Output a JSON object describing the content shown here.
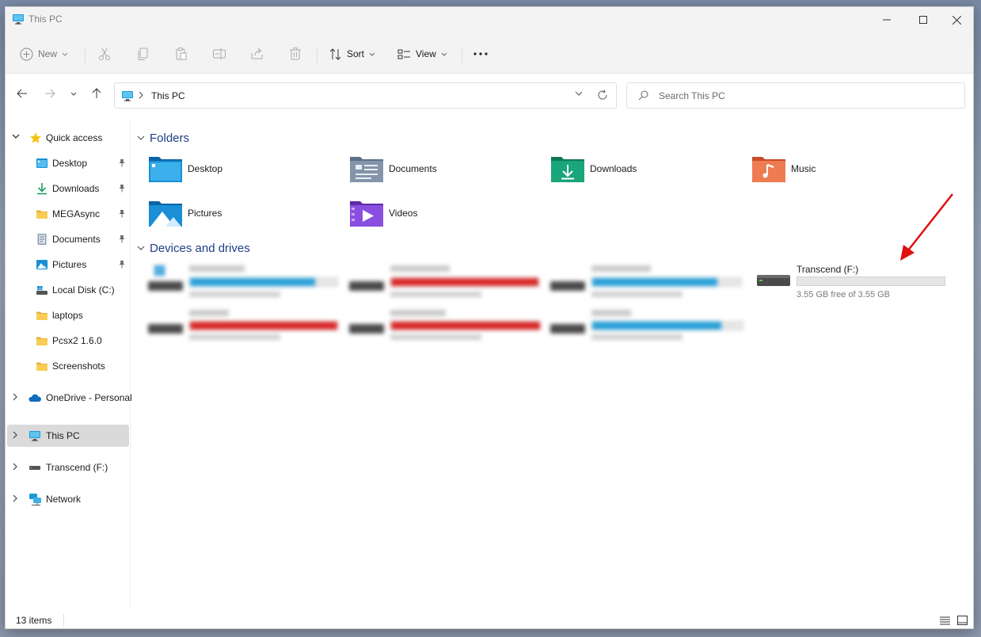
{
  "window": {
    "title": "This PC"
  },
  "toolbar": {
    "new_label": "New",
    "sort_label": "Sort",
    "view_label": "View"
  },
  "address": {
    "crumb": "This PC"
  },
  "search": {
    "placeholder": "Search This PC"
  },
  "sidebar": {
    "quick_access": "Quick access",
    "items": [
      {
        "label": "Desktop"
      },
      {
        "label": "Downloads"
      },
      {
        "label": "MEGAsync"
      },
      {
        "label": "Documents"
      },
      {
        "label": "Pictures"
      },
      {
        "label": "Local Disk (C:)"
      },
      {
        "label": "laptops"
      },
      {
        "label": "Pcsx2 1.6.0"
      },
      {
        "label": "Screenshots"
      }
    ],
    "onedrive": "OneDrive - Personal",
    "this_pc": "This PC",
    "transcend": "Transcend (F:)",
    "network": "Network"
  },
  "folders": {
    "heading": "Folders",
    "items": [
      {
        "name": "Desktop"
      },
      {
        "name": "Documents"
      },
      {
        "name": "Downloads"
      },
      {
        "name": "Music"
      },
      {
        "name": "Pictures"
      },
      {
        "name": "Videos"
      }
    ]
  },
  "drives": {
    "heading": "Devices and drives",
    "transcend": {
      "name": "Transcend (F:)",
      "free": "3.55 GB free of 3.55 GB",
      "used_fraction": 0
    }
  },
  "status": {
    "count": "13 items"
  },
  "colors": {
    "accent": "#1f3d87",
    "bar_blue": "#26a0da",
    "bar_red": "#da2626"
  }
}
